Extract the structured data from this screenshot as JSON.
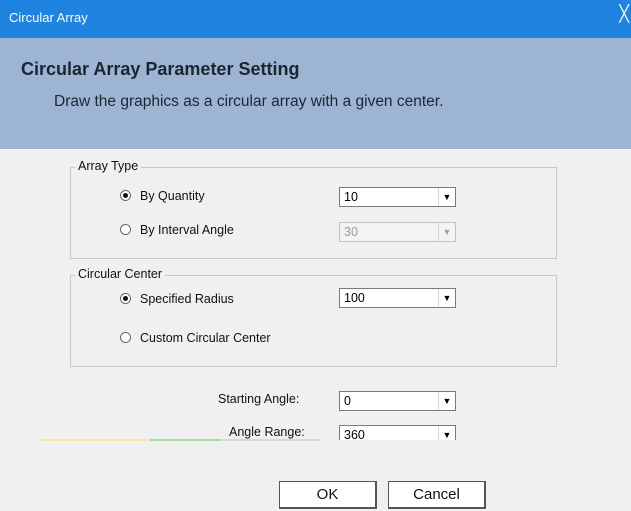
{
  "window": {
    "title": "Circular Array",
    "close_glyph": "╳"
  },
  "header": {
    "title": "Circular Array Parameter Setting",
    "subtitle": "Draw the graphics as a circular array with a given center."
  },
  "array_type": {
    "legend": "Array Type",
    "by_quantity": {
      "label": "By Quantity",
      "selected": true,
      "value": "10"
    },
    "by_interval_angle": {
      "label": "By Interval Angle",
      "selected": false,
      "value": "30",
      "disabled": true
    }
  },
  "circular_center": {
    "legend": "Circular Center",
    "specified_radius": {
      "label": "Specified Radius",
      "selected": true,
      "value": "100"
    },
    "custom_center": {
      "label": "Custom Circular Center",
      "selected": false
    }
  },
  "starting_angle": {
    "label": "Starting Angle:",
    "value": "0"
  },
  "angle_range": {
    "label": "Angle Range:",
    "value": "360"
  },
  "buttons": {
    "ok": "OK",
    "cancel": "Cancel"
  },
  "icons": {
    "dropdown": "▼"
  },
  "colors": {
    "titlebar": "#1e84e0",
    "header": "#9db5d3"
  }
}
